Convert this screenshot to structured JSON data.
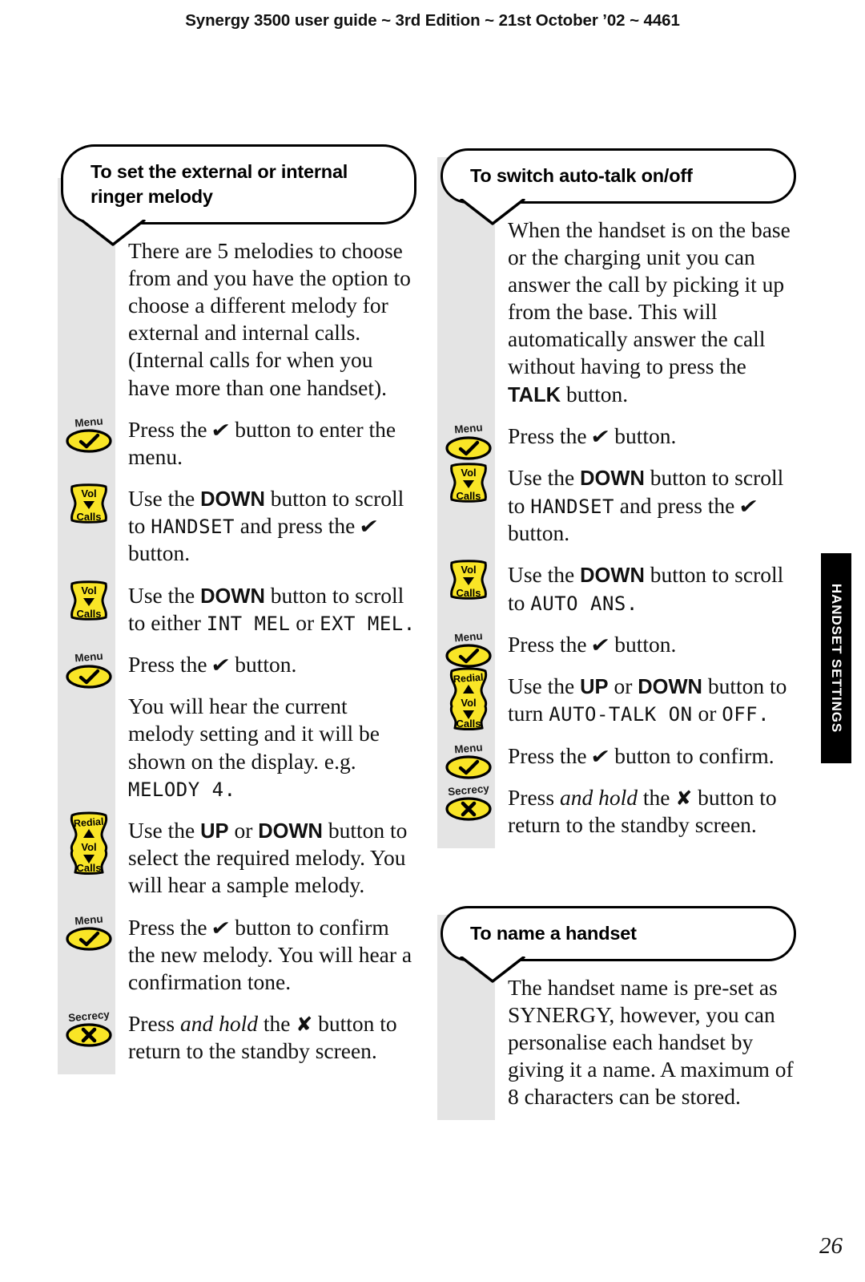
{
  "header": {
    "running_head": "Synergy 3500 user guide ~ 3rd Edition ~ 21st October ’02 ~ 4461"
  },
  "page_number": "26",
  "thumb_tab": {
    "label": "HANDSET SETTINGS",
    "background": "#000000",
    "text_color": "#ffffff"
  },
  "colors": {
    "key_yellow": "#f9e526",
    "spine_grey": "#e4e4e4",
    "outline": "#000000"
  },
  "keys": {
    "menu_caption": "Menu",
    "vol_caption": "Vol",
    "calls_caption": "Calls",
    "redial_caption": "Redial",
    "secrecy_caption": "Secrecy",
    "tick_glyph": "✔",
    "cross_glyph": "✘",
    "up_glyph": "▲",
    "down_glyph": "▼"
  },
  "sections": [
    {
      "id": "ringer-melody",
      "column": "left",
      "title": "To set the external or internal ringer melody",
      "steps": [
        {
          "key": "none",
          "text_html": "There are 5 melodies to choose from and you have the option to choose a different melody for external and internal calls. (Internal calls for when you have more than one handset)."
        },
        {
          "key": "menu",
          "text_html": "Press the <span class=\"tick\">✔</span> button to enter the menu."
        },
        {
          "key": "down",
          "text_html": "Use the <b>DOWN</b> button to scroll to <span class=\"lcd\">HANDSET</span> and press the <span class=\"tick\">✔</span> button."
        },
        {
          "key": "menu",
          "text_html": "__MERGED_WITH_PREVIOUS__"
        },
        {
          "key": "down",
          "text_html": "Use the <b>DOWN</b> button to scroll to either <span class=\"lcd\">INT MEL</span> or <span class=\"lcd\">EXT MEL.</span>"
        },
        {
          "key": "menu",
          "text_html": "Press the <span class=\"tick\">✔</span> button."
        },
        {
          "key": "none",
          "text_html": "You will hear the current melody setting and it will be shown on the display. e.g. <span class=\"lcd\">MELODY 4.</span>"
        },
        {
          "key": "updown",
          "text_html": "Use the <b>UP</b> or <b>DOWN</b> button to select the required melody. You will hear a sample melody."
        },
        {
          "key": "menu",
          "text_html": "Press the <span class=\"tick\">✔</span> button to confirm the new melody. You will hear a confirmation tone."
        },
        {
          "key": "secrecy",
          "text_html": "Press <i>and hold</i> the <span class=\"cross\">✘</span> button to return to the standby screen."
        }
      ]
    },
    {
      "id": "auto-talk",
      "column": "right",
      "title": "To switch auto-talk on/off",
      "steps": [
        {
          "key": "none",
          "text_html": "When the handset is on the base or the charging unit you can answer the call by picking it up from the base. This will automatically answer the call without having to press the <b>TALK</b> button."
        },
        {
          "key": "menu",
          "text_html": "Press the <span class=\"tick\">✔</span> button."
        },
        {
          "key": "down",
          "text_html": "Use the <b>DOWN</b> button to scroll to <span class=\"lcd\">HANDSET</span> and press the <span class=\"tick\">✔</span> button."
        },
        {
          "key": "menu",
          "text_html": "__MERGED_WITH_PREVIOUS__"
        },
        {
          "key": "down",
          "text_html": "Use the <b>DOWN</b> button to scroll to <span class=\"lcd\">AUTO ANS.</span>"
        },
        {
          "key": "menu",
          "text_html": "Press the <span class=\"tick\">✔</span> button."
        },
        {
          "key": "updown",
          "text_html": "Use the <b>UP</b> or <b>DOWN</b> button to turn <span class=\"lcd\">AUTO-TALK ON</span> or <span class=\"lcd\">OFF.</span>"
        },
        {
          "key": "menu",
          "text_html": "Press the <span class=\"tick\">✔</span> button to confirm."
        },
        {
          "key": "secrecy",
          "text_html": "Press <i>and hold</i> the <span class=\"cross\">✘</span> button to return to the standby screen."
        }
      ]
    },
    {
      "id": "name-handset",
      "column": "right",
      "title": "To name a handset",
      "steps": [
        {
          "key": "none",
          "text_html": "The handset name is pre-set as SYNERGY, however, you can personalise each handset by giving it a name. A maximum of 8 characters can be stored."
        }
      ]
    }
  ]
}
